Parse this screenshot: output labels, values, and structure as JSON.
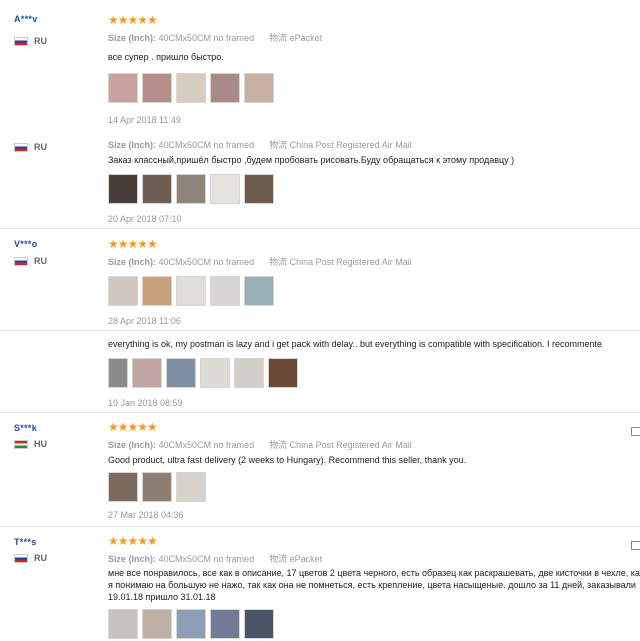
{
  "reviews": [
    {
      "user": "A***v",
      "country": "RU",
      "flag": "ru",
      "stars": "★★★★★",
      "size_label": "Size (Inch):",
      "size_value": "40CMx50CM no framed",
      "ship_label": "物流",
      "ship_value": "ePacket",
      "text": "все супер . пришло быстро.",
      "thumbs": [
        "#c9a3a0",
        "#b58d8a",
        "#d9cdbf",
        "#a98a86",
        "#c6b0a4"
      ],
      "date": "14 Apr 2018 11:49"
    },
    {
      "user": "",
      "country": "RU",
      "flag": "ru",
      "stars": "",
      "size_label": "Size (Inch):",
      "size_value": "40CMx50CM no framed",
      "ship_label": "物流",
      "ship_value": "China Post Registered Air Mail",
      "text": "Заказ классный,пришёл быстро ,будем пробовать рисовать.Буду обращаться к этому продавцу )",
      "thumbs": [
        "#4a3e38",
        "#6e5e54",
        "#8e8478",
        "#e6e3de",
        "#6c5a4a"
      ],
      "date": "20 Apr 2018 07:10"
    },
    {
      "user": "V***o",
      "country": "RU",
      "flag": "ru",
      "stars": "★★★★★",
      "size_label": "Size (Inch):",
      "size_value": "40CMx50CM no framed",
      "ship_label": "物流",
      "ship_value": "China Post Registered Air Mail",
      "text": "",
      "thumbs": [
        "#cfc6c2",
        "#c8a27a",
        "#e1ddd8",
        "#d8d6d2",
        "#9ab0b8"
      ],
      "date": "28 Apr 2018 11:06"
    },
    {
      "user": "",
      "country": "",
      "flag": "",
      "stars": "",
      "size_label": "",
      "size_value": "",
      "ship_label": "",
      "ship_value": "",
      "text": "everything is ok, my postman is lazy and i get pack with delay.. but everything is compatible with specification. I recommente",
      "thumbs": [
        "#8a8a8a",
        "#c0a4a2",
        "#7f8da0",
        "#dedbd6",
        "#d2cfca",
        "#6b4a35"
      ],
      "date": "19 Jan 2018 08:59"
    },
    {
      "user": "S***k",
      "country": "HU",
      "flag": "hu",
      "stars": "★★★★★",
      "size_label": "Size (Inch):",
      "size_value": "40CMx50CM no framed",
      "ship_label": "物流",
      "ship_value": "China Post Registered Air Mail",
      "text": "Good product, ultra fast delivery (2 weeks to Hungary). Recommend this seller, thank you.",
      "thumbs": [
        "#7d6a5e",
        "#8d7f74",
        "#d7d2cb"
      ],
      "date": "27 Mar 2018 04:36"
    },
    {
      "user": "T***s",
      "country": "RU",
      "flag": "ru",
      "stars": "★★★★★",
      "size_label": "Size (Inch):",
      "size_value": "40CMx50CM no framed",
      "ship_label": "物流",
      "ship_value": "ePacket",
      "text": "мне все понравилось, все как в описание, 17 цветов 2 цвета черного, есть образец как раскрашевать, две кисточки в чехле, как я понимаю на большую не нажо, так как она не помнеться, есть крепление, цвета насыщеные. дошло за 11 дней, заказывали 19.01.18 пришло 31.01.18",
      "thumbs": [
        "#c7c4bf",
        "#bdb1a4",
        "#8e9db3",
        "#6f7c94",
        "#4b5568"
      ],
      "date": ""
    }
  ]
}
